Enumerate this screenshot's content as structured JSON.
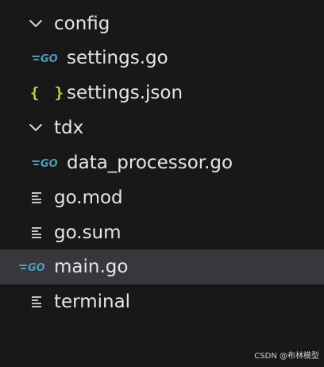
{
  "explorer": {
    "items": [
      {
        "label": "config",
        "type": "folder",
        "icon": "chevron-down-icon"
      },
      {
        "label": "settings.go",
        "type": "file",
        "icon": "go-file-icon"
      },
      {
        "label": "settings.json",
        "type": "file",
        "icon": "json-file-icon"
      },
      {
        "label": "tdx",
        "type": "folder",
        "icon": "chevron-down-icon"
      },
      {
        "label": "data_processor.go",
        "type": "file",
        "icon": "go-file-icon"
      },
      {
        "label": "go.mod",
        "type": "file",
        "icon": "text-file-icon"
      },
      {
        "label": "go.sum",
        "type": "file",
        "icon": "text-file-icon"
      },
      {
        "label": "main.go",
        "type": "file",
        "icon": "go-file-icon",
        "selected": true
      },
      {
        "label": "terminal",
        "type": "file",
        "icon": "text-file-icon"
      }
    ]
  },
  "icons": {
    "json_glyph": "{ }"
  },
  "colors": {
    "background": "#181818",
    "selected_row": "#37373d",
    "text": "#e6e6e6",
    "go_icon": "#519aba",
    "json_icon": "#cbcb41"
  },
  "watermark": "CSDN @布林模型"
}
